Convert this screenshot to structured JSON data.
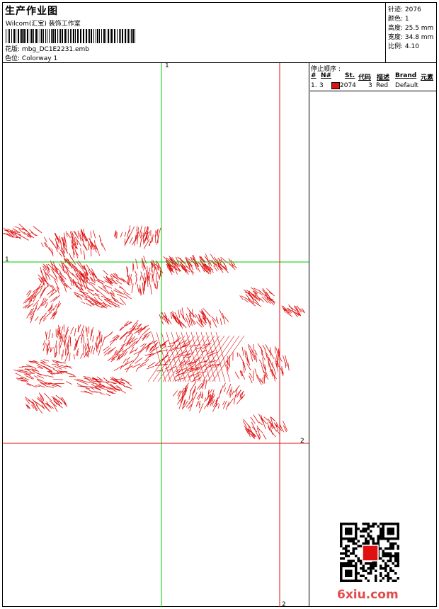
{
  "header": {
    "title": "生产作业图",
    "company": "Wilcom(汇宝) 装饰工作室",
    "design_label": "花版:",
    "design_file": "mbg_DC1E2231.emb",
    "colorway_label": "色位:",
    "colorway": "Colorway 1"
  },
  "stats": {
    "stitches": "针迹: 2076",
    "colors": "颜色: 1",
    "height": "高度: 25.5 mm",
    "width": "宽度: 34.8 mm",
    "scale": "比例: 4.10"
  },
  "stop_sequence": {
    "title": "停止顺序 :",
    "columns": [
      "#",
      "N#",
      "St.",
      "代码",
      "描述",
      "Brand",
      "元素"
    ],
    "rows": [
      {
        "index": "1.",
        "needle": "3",
        "stitches": "2074",
        "code": "3",
        "description": "Red",
        "brand": "Default",
        "element": "",
        "color": "#e01010"
      }
    ]
  },
  "guides": {
    "v1": "1",
    "h1": "1",
    "v2": "2",
    "h2": "2"
  },
  "colors": {
    "stitch": "#e01010",
    "guide_green": "#00c800",
    "guide_red": "#e01010",
    "watermark": "#e24b4b"
  },
  "watermark": "6xiu.com"
}
